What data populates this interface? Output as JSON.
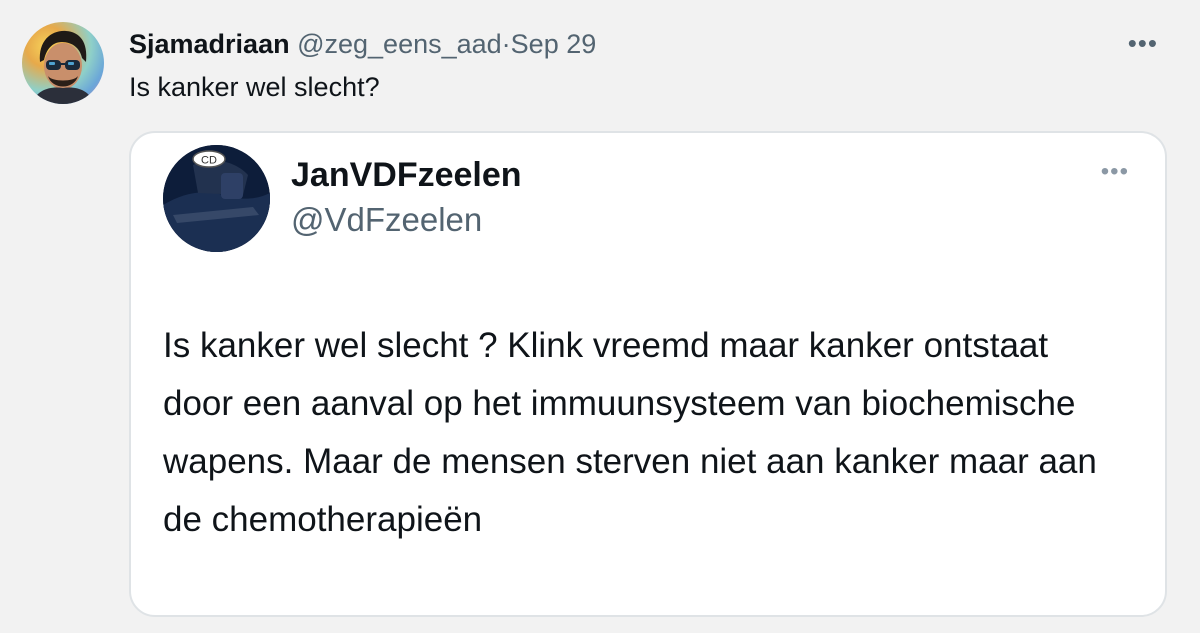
{
  "tweet": {
    "display_name": "Sjamadriaan",
    "handle": "@zeg_eens_aad",
    "separator": "·",
    "date": "Sep 29",
    "text": "Is kanker wel slecht?",
    "more_icon": "•••"
  },
  "quote": {
    "display_name": "JanVDFzeelen",
    "handle": "@VdFzeelen",
    "avatar_badge": "CD",
    "more_icon": "•••",
    "text": "Is kanker wel slecht ? Klink vreemd maar kanker ontstaat door een aanval op het immuunsysteem van biochemische wapens. Maar de mensen sterven niet aan kanker maar aan de chemotherapieën"
  }
}
